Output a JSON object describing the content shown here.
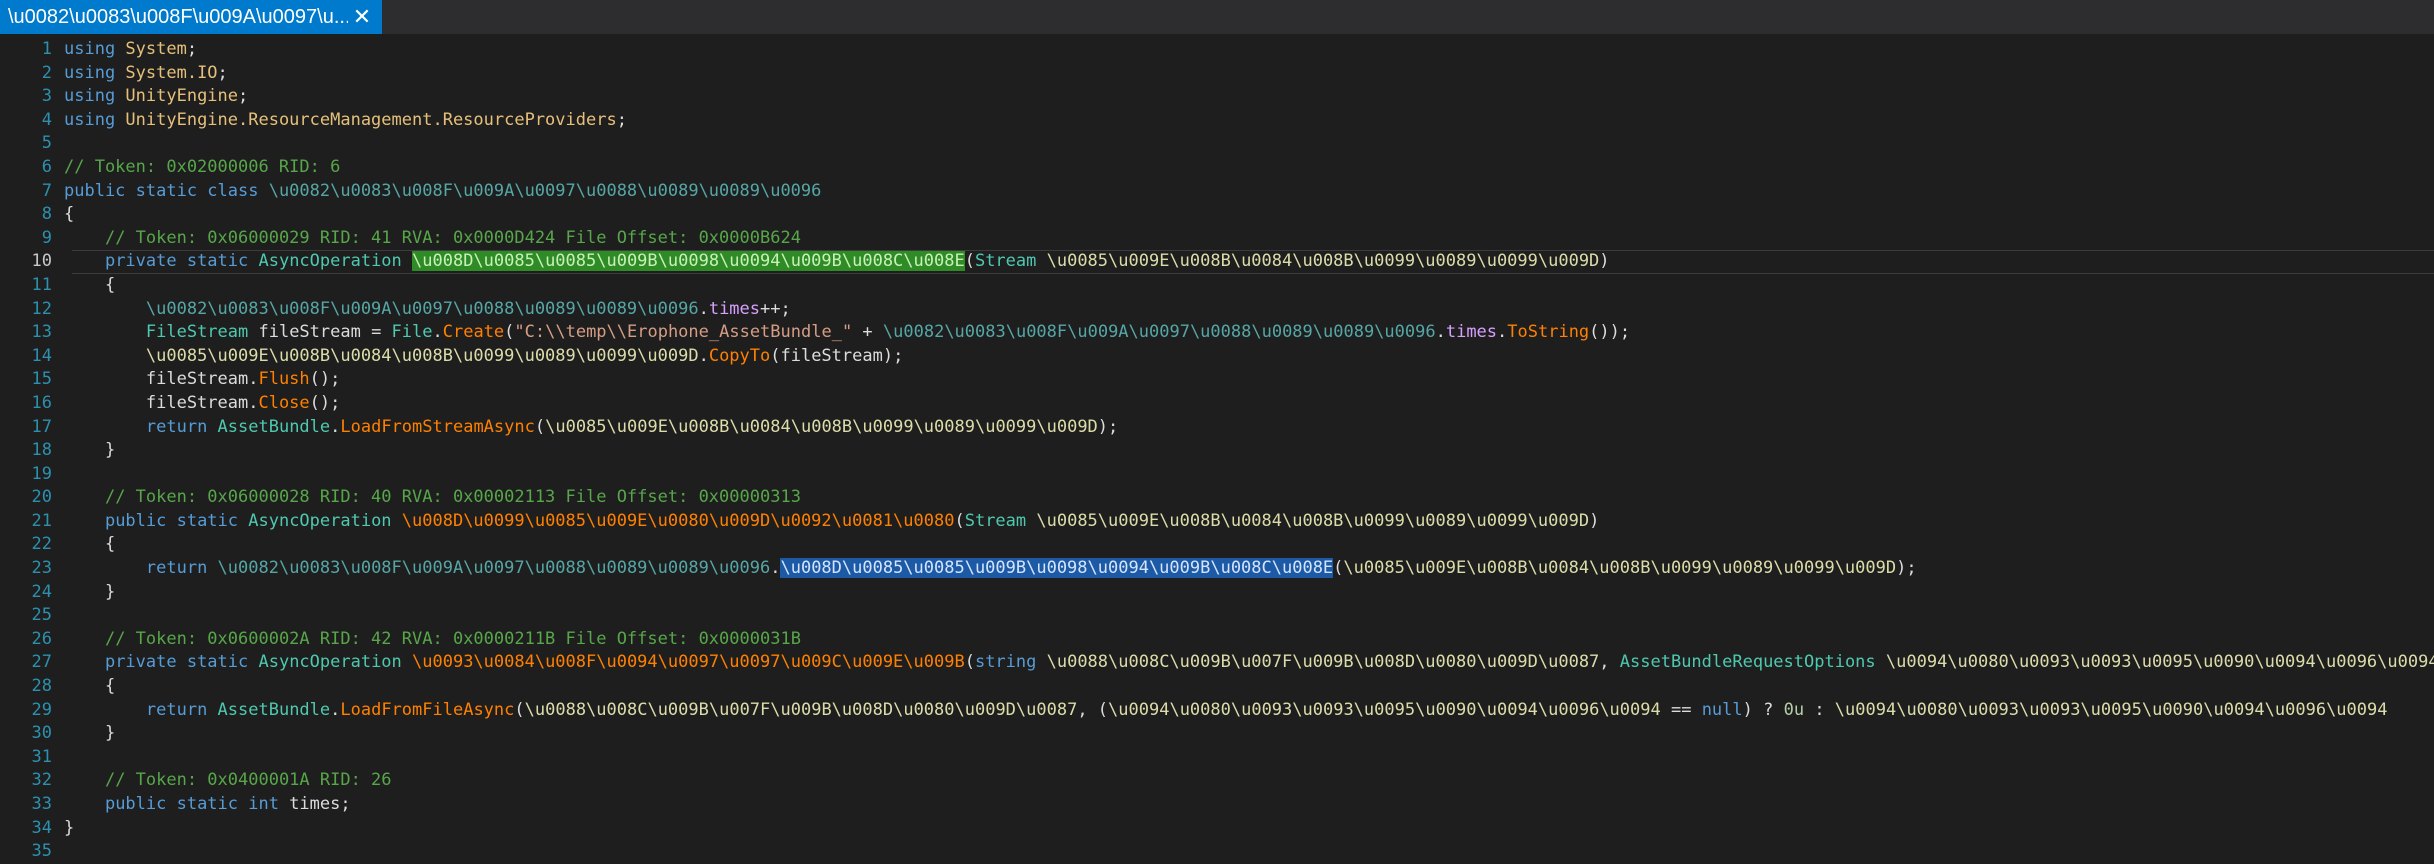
{
  "tab": {
    "title": "\\u0082\\u0083\\u008F\\u009A\\u0097\\u...",
    "close_glyph": "✕"
  },
  "lines": [
    {
      "n": "1",
      "segs": [
        {
          "c": "k",
          "t": "using "
        },
        {
          "c": "ns",
          "t": "System"
        },
        {
          "c": "pl",
          "t": ";"
        }
      ]
    },
    {
      "n": "2",
      "segs": [
        {
          "c": "k",
          "t": "using "
        },
        {
          "c": "ns",
          "t": "System.IO"
        },
        {
          "c": "pl",
          "t": ";"
        }
      ]
    },
    {
      "n": "3",
      "segs": [
        {
          "c": "k",
          "t": "using "
        },
        {
          "c": "ns",
          "t": "UnityEngine"
        },
        {
          "c": "pl",
          "t": ";"
        }
      ]
    },
    {
      "n": "4",
      "segs": [
        {
          "c": "k",
          "t": "using "
        },
        {
          "c": "ns",
          "t": "UnityEngine.ResourceManagement.ResourceProviders"
        },
        {
          "c": "pl",
          "t": ";"
        }
      ]
    },
    {
      "n": "5",
      "segs": []
    },
    {
      "n": "6",
      "segs": [
        {
          "c": "cm",
          "t": "// Token: 0x02000006 RID: 6"
        }
      ]
    },
    {
      "n": "7",
      "segs": [
        {
          "c": "k",
          "t": "public static class "
        },
        {
          "c": "obf",
          "t": "\\u0082\\u0083\\u008F\\u009A\\u0097\\u0088\\u0089\\u0089\\u0096"
        }
      ]
    },
    {
      "n": "8",
      "segs": [
        {
          "c": "pl",
          "t": "{"
        }
      ]
    },
    {
      "n": "9",
      "segs": [
        {
          "c": "pl",
          "t": "    "
        },
        {
          "c": "cm",
          "t": "// Token: 0x06000029 RID: 41 RVA: 0x0000D424 File Offset: 0x0000B624"
        }
      ]
    },
    {
      "n": "10",
      "current": true,
      "segs": [
        {
          "c": "pl",
          "t": "    "
        },
        {
          "c": "k",
          "t": "private static "
        },
        {
          "c": "t",
          "t": "AsyncOperation "
        },
        {
          "c": "hl-green",
          "t": "\\u008D\\u0085\\u0085\\u009B\\u0098\\u0094\\u009B\\u008C\\u008E"
        },
        {
          "c": "pl",
          "t": "("
        },
        {
          "c": "t",
          "t": "Stream "
        },
        {
          "c": "par",
          "t": "\\u0085\\u009E\\u008B\\u0084\\u008B\\u0099\\u0089\\u0099\\u009D"
        },
        {
          "c": "pl",
          "t": ")"
        }
      ]
    },
    {
      "n": "11",
      "segs": [
        {
          "c": "pl",
          "t": "    {"
        }
      ]
    },
    {
      "n": "12",
      "segs": [
        {
          "c": "pl",
          "t": "        "
        },
        {
          "c": "obf",
          "t": "\\u0082\\u0083\\u008F\\u009A\\u0097\\u0088\\u0089\\u0089\\u0096"
        },
        {
          "c": "pl",
          "t": "."
        },
        {
          "c": "fld",
          "t": "times"
        },
        {
          "c": "pl",
          "t": "++;"
        }
      ]
    },
    {
      "n": "13",
      "segs": [
        {
          "c": "pl",
          "t": "        "
        },
        {
          "c": "t",
          "t": "FileStream "
        },
        {
          "c": "pl",
          "t": "fileStream = "
        },
        {
          "c": "t",
          "t": "File"
        },
        {
          "c": "pl",
          "t": "."
        },
        {
          "c": "mcall",
          "t": "Create"
        },
        {
          "c": "pl",
          "t": "("
        },
        {
          "c": "s",
          "t": "\"C:\\\\temp\\\\Erophone_AssetBundle_\""
        },
        {
          "c": "pl",
          "t": " + "
        },
        {
          "c": "obf",
          "t": "\\u0082\\u0083\\u008F\\u009A\\u0097\\u0088\\u0089\\u0089\\u0096"
        },
        {
          "c": "pl",
          "t": "."
        },
        {
          "c": "fld",
          "t": "times"
        },
        {
          "c": "pl",
          "t": "."
        },
        {
          "c": "mcall",
          "t": "ToString"
        },
        {
          "c": "pl",
          "t": "());"
        }
      ]
    },
    {
      "n": "14",
      "segs": [
        {
          "c": "pl",
          "t": "        "
        },
        {
          "c": "par",
          "t": "\\u0085\\u009E\\u008B\\u0084\\u008B\\u0099\\u0089\\u0099\\u009D"
        },
        {
          "c": "pl",
          "t": "."
        },
        {
          "c": "mcall",
          "t": "CopyTo"
        },
        {
          "c": "pl",
          "t": "(fileStream);"
        }
      ]
    },
    {
      "n": "15",
      "segs": [
        {
          "c": "pl",
          "t": "        fileStream."
        },
        {
          "c": "mcall",
          "t": "Flush"
        },
        {
          "c": "pl",
          "t": "();"
        }
      ]
    },
    {
      "n": "16",
      "segs": [
        {
          "c": "pl",
          "t": "        fileStream."
        },
        {
          "c": "mcall",
          "t": "Close"
        },
        {
          "c": "pl",
          "t": "();"
        }
      ]
    },
    {
      "n": "17",
      "segs": [
        {
          "c": "pl",
          "t": "        "
        },
        {
          "c": "k",
          "t": "return "
        },
        {
          "c": "t",
          "t": "AssetBundle"
        },
        {
          "c": "pl",
          "t": "."
        },
        {
          "c": "mcall",
          "t": "LoadFromStreamAsync"
        },
        {
          "c": "pl",
          "t": "("
        },
        {
          "c": "par",
          "t": "\\u0085\\u009E\\u008B\\u0084\\u008B\\u0099\\u0089\\u0099\\u009D"
        },
        {
          "c": "pl",
          "t": ");"
        }
      ]
    },
    {
      "n": "18",
      "segs": [
        {
          "c": "pl",
          "t": "    }"
        }
      ]
    },
    {
      "n": "19",
      "segs": []
    },
    {
      "n": "20",
      "segs": [
        {
          "c": "pl",
          "t": "    "
        },
        {
          "c": "cm",
          "t": "// Token: 0x06000028 RID: 40 RVA: 0x00002113 File Offset: 0x00000313"
        }
      ]
    },
    {
      "n": "21",
      "segs": [
        {
          "c": "pl",
          "t": "    "
        },
        {
          "c": "k",
          "t": "public static "
        },
        {
          "c": "t",
          "t": "AsyncOperation "
        },
        {
          "c": "m",
          "t": "\\u008D\\u0099\\u0085\\u009E\\u0080\\u009D\\u0092\\u0081\\u0080"
        },
        {
          "c": "pl",
          "t": "("
        },
        {
          "c": "t",
          "t": "Stream "
        },
        {
          "c": "par",
          "t": "\\u0085\\u009E\\u008B\\u0084\\u008B\\u0099\\u0089\\u0099\\u009D"
        },
        {
          "c": "pl",
          "t": ")"
        }
      ]
    },
    {
      "n": "22",
      "segs": [
        {
          "c": "pl",
          "t": "    {"
        }
      ]
    },
    {
      "n": "23",
      "segs": [
        {
          "c": "pl",
          "t": "        "
        },
        {
          "c": "k",
          "t": "return "
        },
        {
          "c": "obf",
          "t": "\\u0082\\u0083\\u008F\\u009A\\u0097\\u0088\\u0089\\u0089\\u0096"
        },
        {
          "c": "pl",
          "t": "."
        },
        {
          "c": "hl-blue",
          "t": "\\u008D\\u0085\\u0085\\u009B\\u0098\\u0094\\u009B\\u008C\\u008E"
        },
        {
          "c": "pl",
          "t": "("
        },
        {
          "c": "par",
          "t": "\\u0085\\u009E\\u008B\\u0084\\u008B\\u0099\\u0089\\u0099\\u009D"
        },
        {
          "c": "pl",
          "t": ");"
        }
      ]
    },
    {
      "n": "24",
      "segs": [
        {
          "c": "pl",
          "t": "    }"
        }
      ]
    },
    {
      "n": "25",
      "segs": []
    },
    {
      "n": "26",
      "segs": [
        {
          "c": "pl",
          "t": "    "
        },
        {
          "c": "cm",
          "t": "// Token: 0x0600002A RID: 42 RVA: 0x0000211B File Offset: 0x0000031B"
        }
      ]
    },
    {
      "n": "27",
      "segs": [
        {
          "c": "pl",
          "t": "    "
        },
        {
          "c": "k",
          "t": "private static "
        },
        {
          "c": "t",
          "t": "AsyncOperation "
        },
        {
          "c": "m",
          "t": "\\u0093\\u0084\\u008F\\u0094\\u0097\\u0097\\u009C\\u009E\\u009B"
        },
        {
          "c": "pl",
          "t": "("
        },
        {
          "c": "k",
          "t": "string "
        },
        {
          "c": "par",
          "t": "\\u0088\\u008C\\u009B\\u007F\\u009B\\u008D\\u0080\\u009D\\u0087"
        },
        {
          "c": "pl",
          "t": ", "
        },
        {
          "c": "t",
          "t": "AssetBundleRequestOptions "
        },
        {
          "c": "par",
          "t": "\\u0094\\u0080\\u0093\\u0093\\u0095\\u0090\\u0094\\u0096\\u0094"
        },
        {
          "c": "pl",
          "t": ")"
        }
      ]
    },
    {
      "n": "28",
      "segs": [
        {
          "c": "pl",
          "t": "    {"
        }
      ]
    },
    {
      "n": "29",
      "segs": [
        {
          "c": "pl",
          "t": "        "
        },
        {
          "c": "k",
          "t": "return "
        },
        {
          "c": "t",
          "t": "AssetBundle"
        },
        {
          "c": "pl",
          "t": "."
        },
        {
          "c": "mcall",
          "t": "LoadFromFileAsync"
        },
        {
          "c": "pl",
          "t": "("
        },
        {
          "c": "par",
          "t": "\\u0088\\u008C\\u009B\\u007F\\u009B\\u008D\\u0080\\u009D\\u0087"
        },
        {
          "c": "pl",
          "t": ", ("
        },
        {
          "c": "par",
          "t": "\\u0094\\u0080\\u0093\\u0093\\u0095\\u0090\\u0094\\u0096\\u0094"
        },
        {
          "c": "pl",
          "t": " == "
        },
        {
          "c": "k",
          "t": "null"
        },
        {
          "c": "pl",
          "t": ") ? "
        },
        {
          "c": "n",
          "t": "0u"
        },
        {
          "c": "pl",
          "t": " : "
        },
        {
          "c": "par",
          "t": "\\u0094\\u0080\\u0093\\u0093\\u0095\\u0090\\u0094\\u0096\\u0094"
        }
      ]
    },
    {
      "n": "30",
      "segs": [
        {
          "c": "pl",
          "t": "    }"
        }
      ]
    },
    {
      "n": "31",
      "segs": []
    },
    {
      "n": "32",
      "segs": [
        {
          "c": "pl",
          "t": "    "
        },
        {
          "c": "cm",
          "t": "// Token: 0x0400001A RID: 26"
        }
      ]
    },
    {
      "n": "33",
      "segs": [
        {
          "c": "pl",
          "t": "    "
        },
        {
          "c": "k",
          "t": "public static int "
        },
        {
          "c": "pl",
          "t": "times;"
        }
      ]
    },
    {
      "n": "34",
      "segs": [
        {
          "c": "pl",
          "t": "}"
        }
      ]
    },
    {
      "n": "35",
      "segs": []
    }
  ]
}
